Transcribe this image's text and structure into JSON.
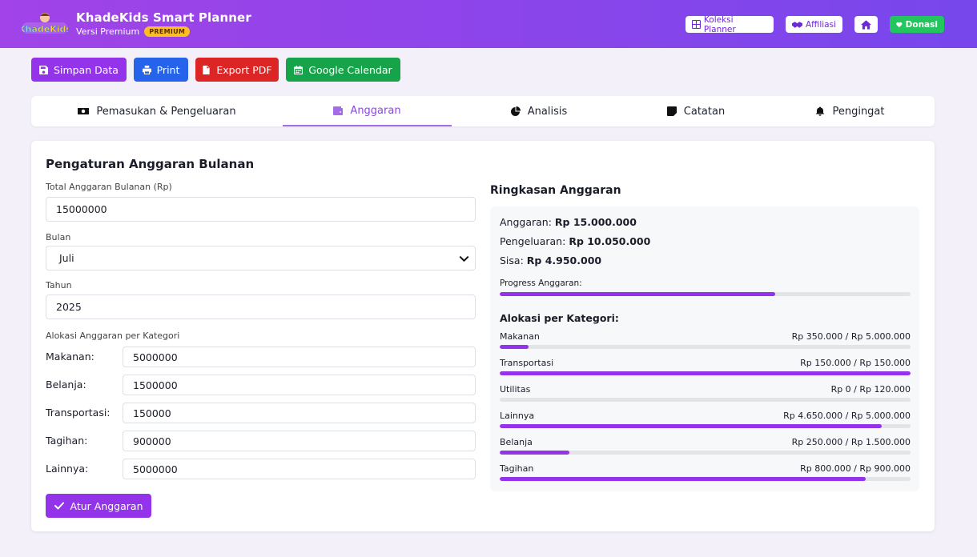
{
  "app": {
    "title": "KhadeKids Smart Planner",
    "version": "Versi Premium",
    "badge": "PREMIUM",
    "logo_text": "KhadeKids"
  },
  "header_buttons": {
    "koleksi": "Koleksi Planner",
    "affiliasi": "Affiliasi",
    "donasi": "Donasi"
  },
  "toolbar": {
    "save": "Simpan Data",
    "print": "Print",
    "export": "Export PDF",
    "calendar": "Google Calendar"
  },
  "tabs": [
    {
      "label": "Pemasukan & Pengeluaran"
    },
    {
      "label": "Anggaran"
    },
    {
      "label": "Analisis"
    },
    {
      "label": "Catatan"
    },
    {
      "label": "Pengingat"
    }
  ],
  "form": {
    "title": "Pengaturan Anggaran Bulanan",
    "total_label": "Total Anggaran Bulanan (Rp)",
    "total_value": "15000000",
    "month_label": "Bulan",
    "month_value": "Juli",
    "year_label": "Tahun",
    "year_value": "2025",
    "alloc_label": "Alokasi Anggaran per Kategori",
    "categories": [
      {
        "label": "Makanan:",
        "value": "5000000"
      },
      {
        "label": "Belanja:",
        "value": "1500000"
      },
      {
        "label": "Transportasi:",
        "value": "150000"
      },
      {
        "label": "Tagihan:",
        "value": "900000"
      },
      {
        "label": "Lainnya:",
        "value": "5000000"
      }
    ],
    "submit": "Atur Anggaran"
  },
  "summary": {
    "title": "Ringkasan Anggaran",
    "budget_label": "Anggaran:",
    "budget_value": "Rp 15.000.000",
    "spent_label": "Pengeluaran:",
    "spent_value": "Rp 10.050.000",
    "rest_label": "Sisa:",
    "rest_value": "Rp 4.950.000",
    "progress_label": "Progress Anggaran:",
    "progress": 0.67,
    "alloc_title": "Alokasi per Kategori:",
    "allocations": [
      {
        "name": "Makanan",
        "value": "Rp 350.000 / Rp 5.000.000",
        "fraction": 0.07
      },
      {
        "name": "Transportasi",
        "value": "Rp 150.000 / Rp 150.000",
        "fraction": 1.0
      },
      {
        "name": "Utilitas",
        "value": "Rp 0 / Rp 120.000",
        "fraction": 0.0
      },
      {
        "name": "Lainnya",
        "value": "Rp 4.650.000 / Rp 5.000.000",
        "fraction": 0.93
      },
      {
        "name": "Belanja",
        "value": "Rp 250.000 / Rp 1.500.000",
        "fraction": 0.17
      },
      {
        "name": "Tagihan",
        "value": "Rp 800.000 / Rp 900.000",
        "fraction": 0.89
      }
    ]
  },
  "colors": {
    "accent": "#9333ea",
    "print": "#2563eb",
    "export": "#dc2626",
    "calendar": "#16a34a",
    "donasi": "#22c55e"
  }
}
